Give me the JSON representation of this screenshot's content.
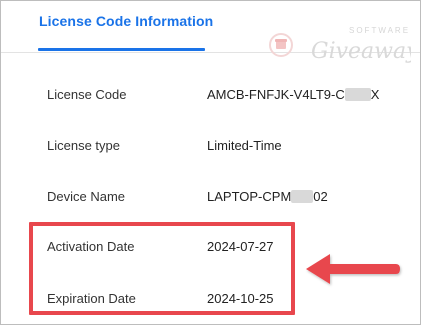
{
  "tab": {
    "label": "License Code Information"
  },
  "watermark": {
    "top_text": "SOFTWARE",
    "main_text": "Giveaway"
  },
  "rows": [
    {
      "label": "License Code",
      "value_start": "AMCB-FNFJK-V4LT9-C",
      "value_end": "X"
    },
    {
      "label": "License type",
      "value": "Limited-Time"
    },
    {
      "label": "Device Name",
      "value_start": "LAPTOP-CPM",
      "value_end": "02"
    },
    {
      "label": "Activation Date",
      "value": "2024-07-27"
    },
    {
      "label": "Expiration Date",
      "value": "2024-10-25"
    }
  ],
  "colors": {
    "accent": "#1a73e8",
    "highlight": "#e8474d"
  }
}
